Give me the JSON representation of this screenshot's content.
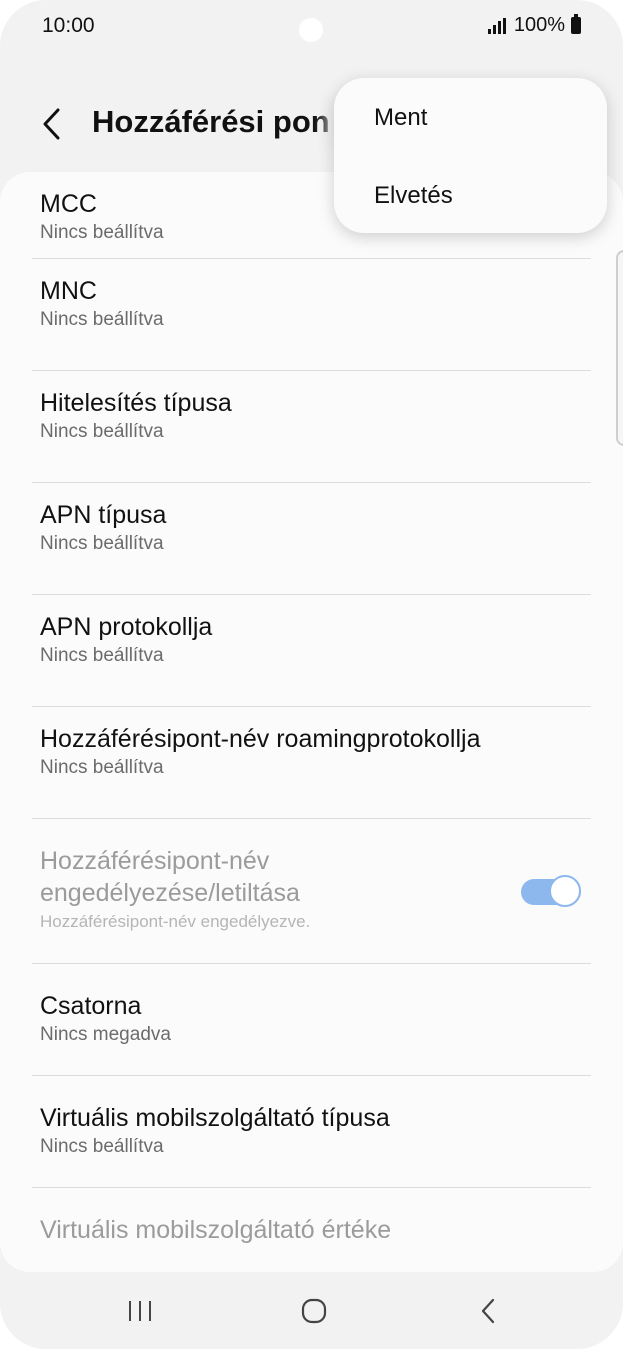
{
  "status_bar": {
    "time": "10:00",
    "battery": "100%"
  },
  "header": {
    "title": "Hozzáférési pon"
  },
  "popup_menu": {
    "items": [
      "Ment",
      "Elvetés"
    ]
  },
  "settings": [
    {
      "title": "MCC",
      "value": "Nincs beállítva"
    },
    {
      "title": "MNC",
      "value": "Nincs beállítva"
    },
    {
      "title": "Hitelesítés típusa",
      "value": "Nincs beállítva"
    },
    {
      "title": "APN típusa",
      "value": "Nincs beállítva"
    },
    {
      "title": "APN protokollja",
      "value": "Nincs beállítva"
    },
    {
      "title": "Hozzáférésipont-név roamingprotokollja",
      "value": "Nincs beállítva"
    },
    {
      "title_line1": "Hozzáférésipont-név",
      "title_line2": "engedélyezése/letiltása",
      "value": "Hozzáférésipont-név engedélyezve.",
      "toggle_on": true
    },
    {
      "title": "Csatorna",
      "value": "Nincs megadva"
    },
    {
      "title": "Virtuális mobilszolgáltató típusa",
      "value": "Nincs beállítva"
    },
    {
      "title": "Virtuális mobilszolgáltató értéke",
      "value": ""
    }
  ],
  "colors": {
    "toggle": "#8db8ee",
    "card": "#fbfbfb",
    "background": "#f2f2f2"
  }
}
